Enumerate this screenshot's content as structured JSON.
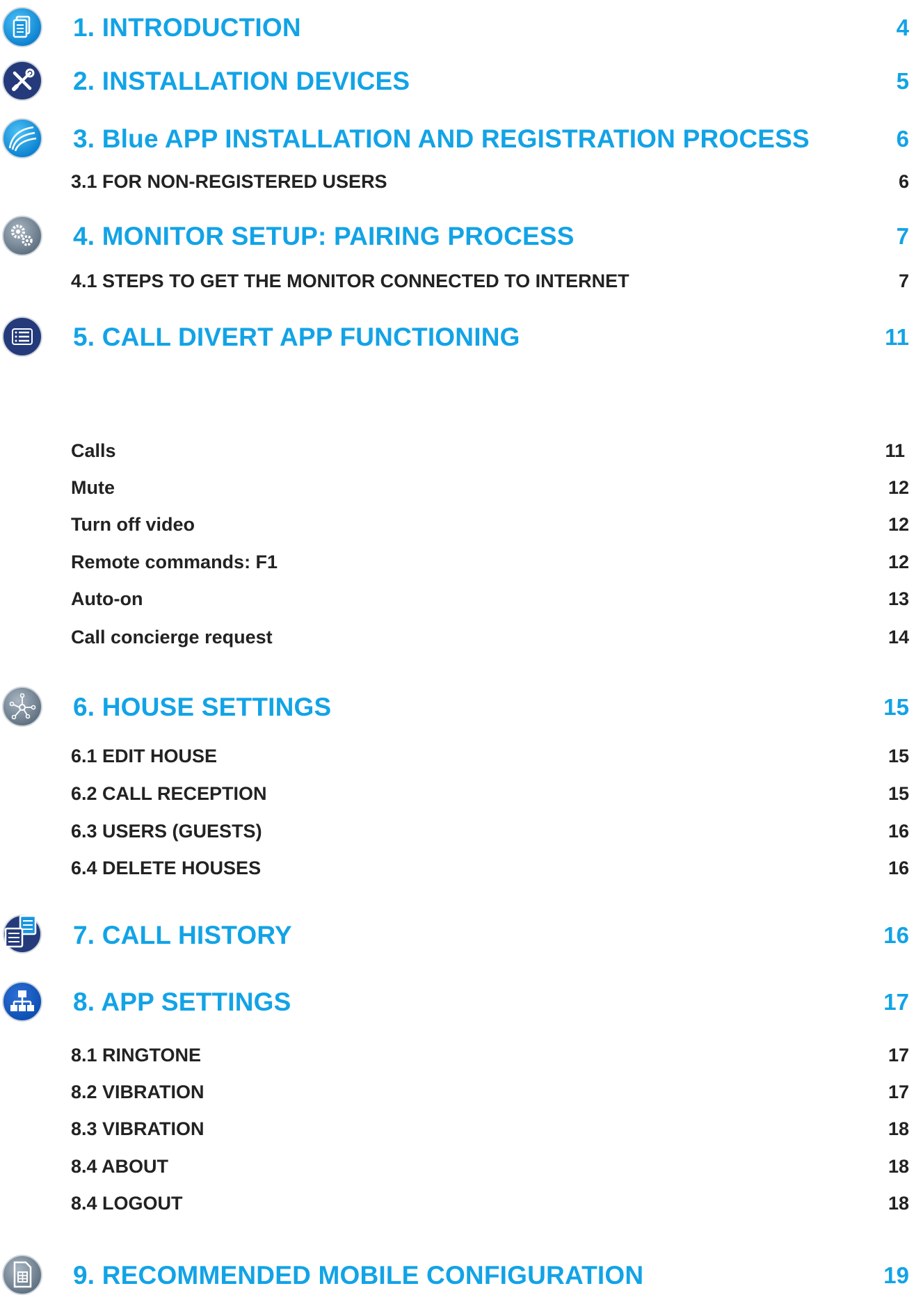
{
  "colors": {
    "accent": "#12a3e6",
    "dark_navy": "#243a7a",
    "gray_icon": "#7a8a99",
    "body_text": "#222222"
  },
  "toc": [
    {
      "icon": "document-icon",
      "title": "1. INTRODUCTION",
      "page": "4",
      "subs": []
    },
    {
      "icon": "tools-icon",
      "title": "2. INSTALLATION DEVICES",
      "page": "5",
      "subs": []
    },
    {
      "icon": "wifi-arcs-icon",
      "title": "3. Blue APP INSTALLATION AND REGISTRATION PROCESS",
      "page": "6",
      "subs": [
        {
          "label": "3.1 FOR NON-REGISTERED USERS",
          "page": "6"
        }
      ]
    },
    {
      "icon": "gears-icon",
      "title": "4. MONITOR SETUP: PAIRING PROCESS",
      "page": "7",
      "subs": [
        {
          "label": "4.1 STEPS TO GET THE MONITOR CONNECTED TO INTERNET",
          "page": "7"
        }
      ]
    },
    {
      "icon": "list-icon",
      "title": "5. CALL DIVERT APP FUNCTIONING",
      "page": "11",
      "subs": [
        {
          "label": "Calls",
          "page": "11"
        },
        {
          "label": "Mute",
          "page": "12"
        },
        {
          "label": "Turn off video",
          "page": "12"
        },
        {
          "label": "Remote commands: F1",
          "page": "12"
        },
        {
          "label": "Auto-on",
          "page": "13"
        },
        {
          "label": "Call concierge request",
          "page": "14"
        }
      ]
    },
    {
      "icon": "network-icon",
      "title": "6. HOUSE SETTINGS",
      "page": "15",
      "subs": [
        {
          "label": "6.1 EDIT HOUSE",
          "page": "15"
        },
        {
          "label": "6.2 CALL RECEPTION",
          "page": "15"
        },
        {
          "label": "6.3 USERS (GUESTS)",
          "page": "16"
        },
        {
          "label": "6.4 DELETE HOUSES",
          "page": "16"
        }
      ]
    },
    {
      "icon": "history-icon",
      "title": "7. CALL HISTORY",
      "page": "16",
      "subs": []
    },
    {
      "icon": "sitemap-icon",
      "title": "8. APP SETTINGS",
      "page": "17",
      "subs": [
        {
          "label": "8.1 RINGTONE",
          "page": "17"
        },
        {
          "label": "8.2 VIBRATION",
          "page": "17"
        },
        {
          "label": "8.3 VIBRATION",
          "page": "18"
        },
        {
          "label": "8.4 ABOUT",
          "page": "18"
        },
        {
          "label": "8.4 LOGOUT",
          "page": "18"
        }
      ]
    },
    {
      "icon": "spreadsheet-icon",
      "title": "9. RECOMMENDED MOBILE CONFIGURATION",
      "page": "19",
      "subs": []
    }
  ]
}
